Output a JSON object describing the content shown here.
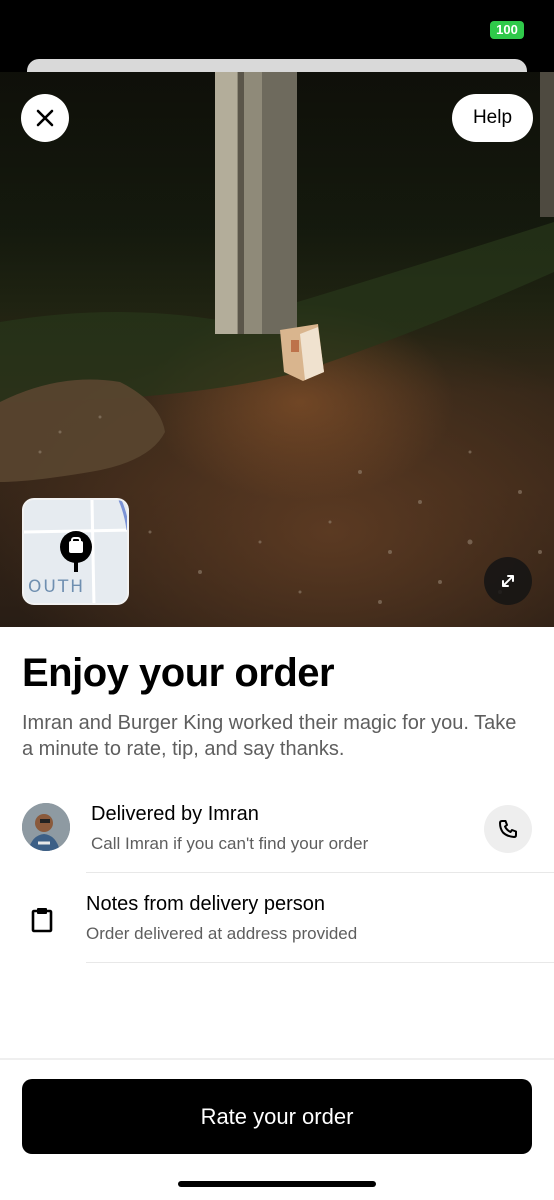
{
  "status_bar": {
    "battery": "100"
  },
  "header": {
    "help_label": "Help"
  },
  "map": {
    "label": "OUTH"
  },
  "order": {
    "title": "Enjoy your order",
    "subtitle": "Imran and Burger King worked their magic for you. Take a minute to rate, tip, and say thanks."
  },
  "delivery": {
    "title": "Delivered by Imran",
    "subtitle": "Call Imran if you can't find your order"
  },
  "notes": {
    "title": "Notes from delivery person",
    "subtitle": "Order delivered at address provided"
  },
  "footer": {
    "rate_label": "Rate your order"
  },
  "colors": {
    "battery": "#2fc94a",
    "button": "#000000",
    "secondary_text": "#5e5e5e"
  },
  "icons": {
    "close": "close-icon",
    "expand": "expand-icon",
    "phone": "phone-icon",
    "clipboard": "clipboard-icon",
    "map_pin": "map-pin-icon"
  }
}
